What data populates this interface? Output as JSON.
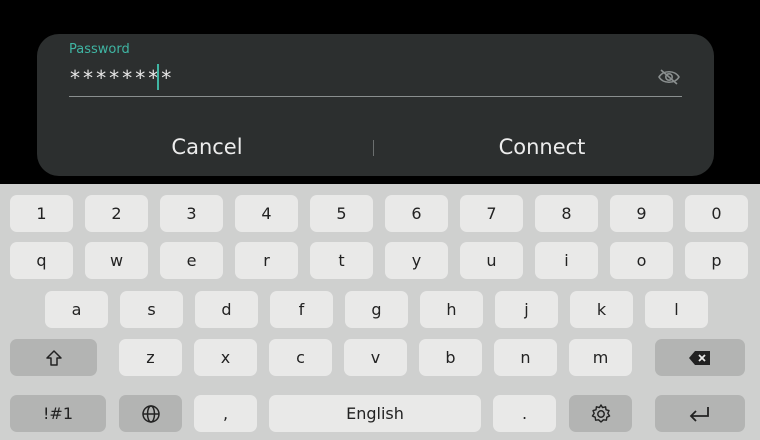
{
  "dialog": {
    "password_label": "Password",
    "password_value": "********",
    "visibility_icon": "eye-off-icon",
    "cancel_label": "Cancel",
    "connect_label": "Connect"
  },
  "keyboard": {
    "row_numbers": [
      "1",
      "2",
      "3",
      "4",
      "5",
      "6",
      "7",
      "8",
      "9",
      "0"
    ],
    "row_q": [
      "q",
      "w",
      "e",
      "r",
      "t",
      "y",
      "u",
      "i",
      "o",
      "p"
    ],
    "row_a": [
      "a",
      "s",
      "d",
      "f",
      "g",
      "h",
      "j",
      "k",
      "l"
    ],
    "row_z": [
      "z",
      "x",
      "c",
      "v",
      "b",
      "n",
      "m"
    ],
    "symbols_label": "!#1",
    "comma_label": ",",
    "space_label": "English",
    "period_label": ".",
    "shift_icon": "shift-icon",
    "backspace_icon": "backspace-icon",
    "language_icon": "globe-icon",
    "settings_icon": "gear-icon",
    "enter_icon": "enter-icon"
  },
  "colors": {
    "accent": "#3fb5a3",
    "dialog_bg": "#2c2f2f",
    "keyboard_bg": "#cfd0cf",
    "key_bg": "#e9e9e8",
    "function_key_bg": "#b3b4b3"
  }
}
